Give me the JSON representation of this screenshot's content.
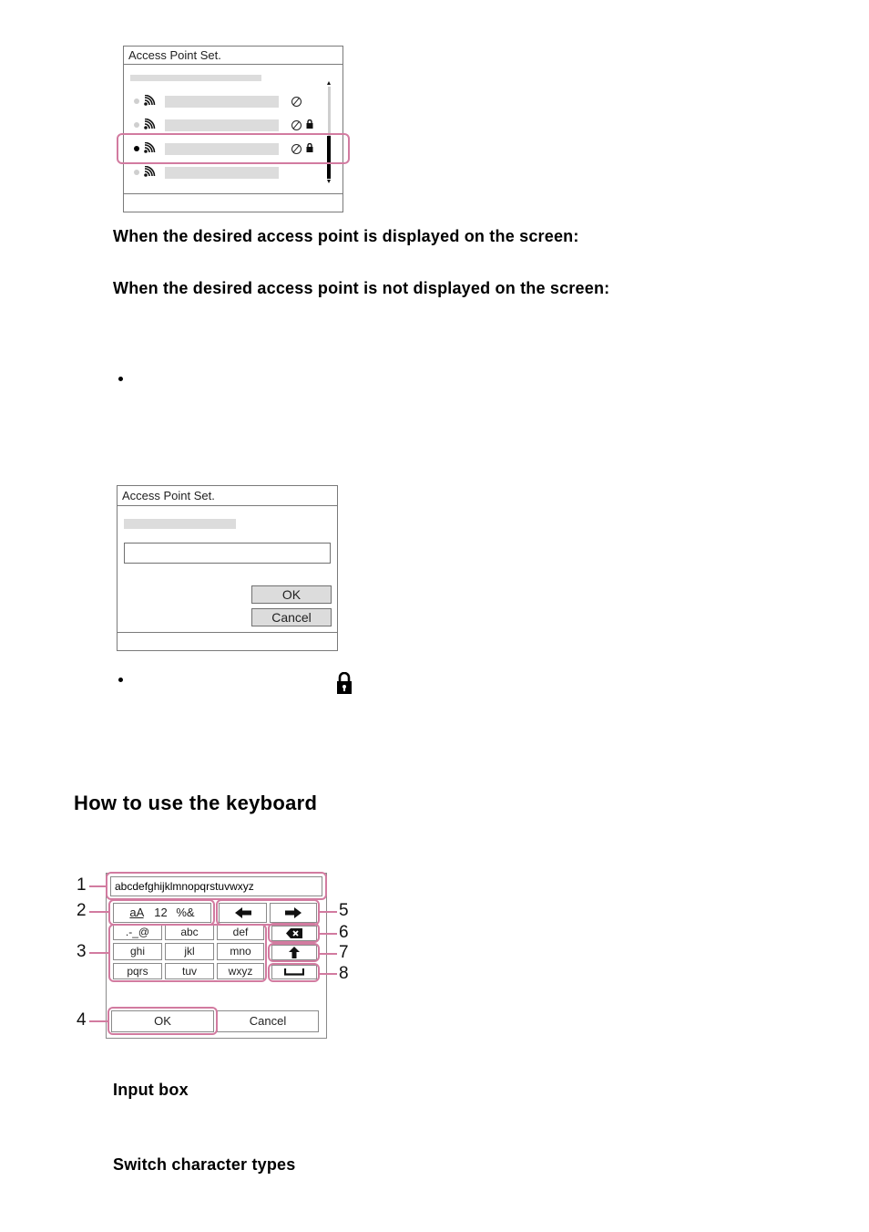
{
  "colors": {
    "highlight": "#d27ba0",
    "placeholder_bar": "#dcdcdc",
    "panel_border": "#7a7a7a",
    "text": "#000000"
  },
  "ap_list_screen": {
    "title": "Access Point Set.",
    "rows": [
      {
        "selected": false,
        "icons": [
          "wifi-signal-icon",
          "wps-icon"
        ]
      },
      {
        "selected": false,
        "icons": [
          "wifi-signal-icon",
          "wps-icon",
          "lock-icon"
        ]
      },
      {
        "selected": true,
        "icons": [
          "wifi-signal-icon",
          "wps-icon",
          "lock-icon"
        ]
      },
      {
        "selected": false,
        "icons": [
          "wifi-signal-icon"
        ]
      }
    ]
  },
  "headings": {
    "displayed": "When the desired access point is displayed on the screen:",
    "not_displayed": "When the desired access point is not displayed on the screen:"
  },
  "password_screen": {
    "title": "Access Point Set.",
    "ok_label": "OK",
    "cancel_label": "Cancel"
  },
  "section_title": "How to use the keyboard",
  "keyboard": {
    "input_value": "abcdefghijklmnopqrstuvwxyz",
    "char_type_labels": [
      "aA",
      "12",
      "%&"
    ],
    "keys": [
      [
        ".-_@",
        "abc",
        "def"
      ],
      [
        "ghi",
        "jkl",
        "mno"
      ],
      [
        "pqrs",
        "tuv",
        "wxyz"
      ]
    ],
    "ok_label": "OK",
    "cancel_label": "Cancel",
    "callouts": [
      "1",
      "2",
      "3",
      "4",
      "5",
      "6",
      "7",
      "8"
    ]
  },
  "labels": {
    "input_box": "Input box",
    "switch_types": "Switch character types"
  }
}
